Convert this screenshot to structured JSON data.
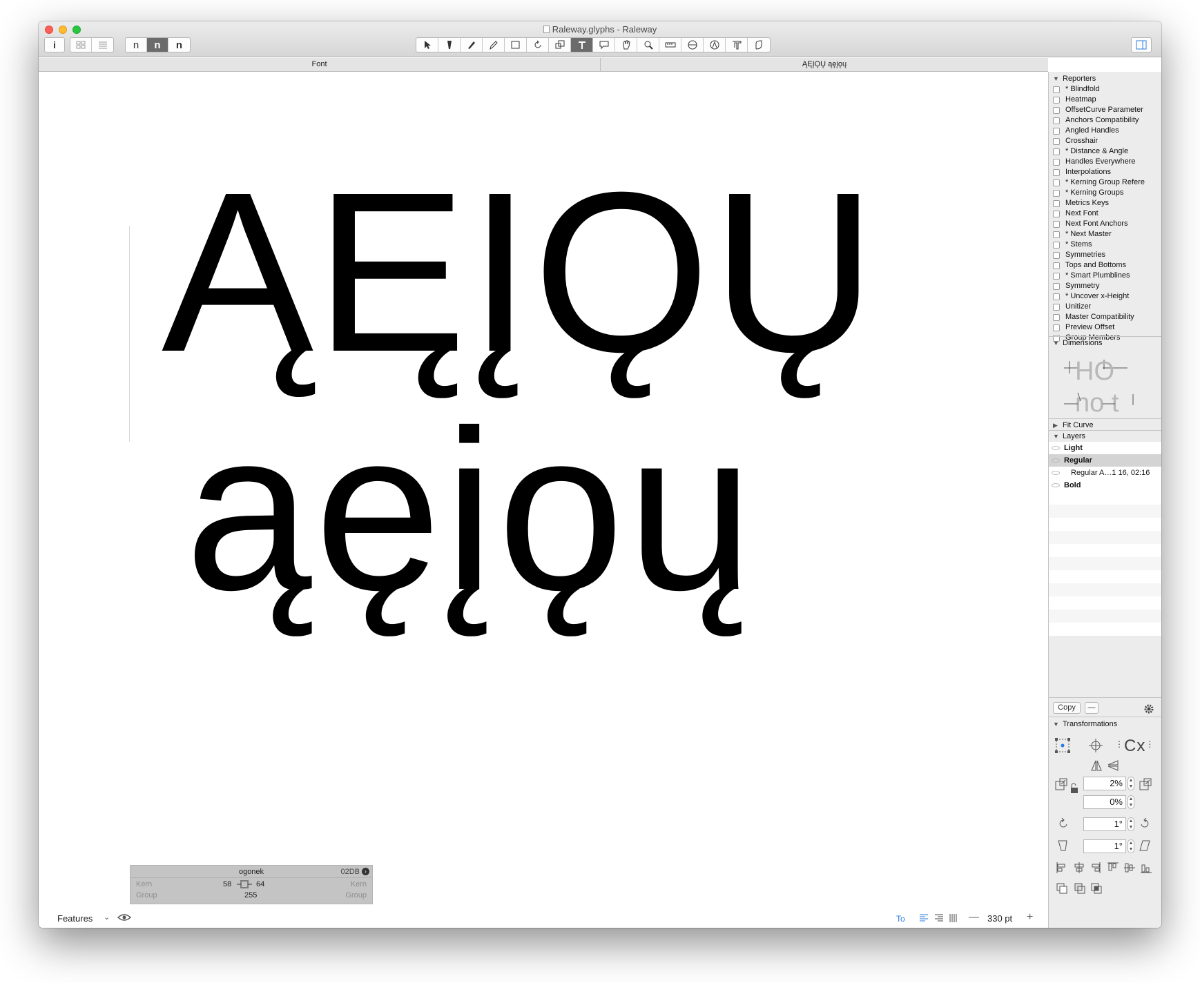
{
  "window": {
    "title": "Raleway.glyphs - Raleway"
  },
  "toolbar": {
    "info_label": "i",
    "preview_labels": [
      "n",
      "n",
      "n"
    ]
  },
  "tabs": [
    {
      "label": "Font"
    },
    {
      "label": "ĄĘĮǪŲ ąęįǫų"
    }
  ],
  "canvas": {
    "line1": "ĄĘĮǪŲ",
    "line2": "ąęįǫų"
  },
  "glyph_info": {
    "name": "ogonek",
    "unicode": "02DB",
    "kern_left_label": "Kern",
    "kern_right_label": "Kern",
    "group_left_label": "Group",
    "group_right_label": "Group",
    "lsb": "58",
    "rsb": "64",
    "width": "255"
  },
  "bottom_bar": {
    "features_label": "Features",
    "zoom": "330 pt",
    "zoom_minus": "—",
    "zoom_plus": "+"
  },
  "sidebar": {
    "reporters_title": "Reporters",
    "reporters": [
      "* Blindfold",
      "Heatmap",
      "OffsetCurve Parameter",
      "Anchors Compatibility",
      "Angled Handles",
      "Crosshair",
      "* Distance & Angle",
      "Handles Everywhere",
      "Interpolations",
      "* Kerning Group Refere",
      "* Kerning Groups",
      "Metrics Keys",
      "Next Font",
      "Next Font Anchors",
      "* Next Master",
      "* Stems",
      "Symmetries",
      "Tops and Bottoms",
      "* Smart Plumblines",
      "Symmetry",
      "* Uncover x-Height",
      "Unitizer",
      "Master Compatibility",
      "Preview Offset",
      "Group Members"
    ],
    "dimensions_title": "Dimensions",
    "dimensions_sample_top": "HO",
    "dimensions_sample_bottom": "no t",
    "fit_curve_title": "Fit Curve",
    "layers_title": "Layers",
    "layers": [
      {
        "name": "Light",
        "bold": true
      },
      {
        "name": "Regular",
        "bold": true,
        "selected": true
      },
      {
        "name": "Regular A…1 16, 02:16",
        "bold": false
      },
      {
        "name": "Bold",
        "bold": true
      }
    ],
    "copy_label": "Copy",
    "minus_label": "—",
    "transformations_title": "Transformations",
    "cx_label": "Cx",
    "scale_x": "2%",
    "scale_y": "0%",
    "rotate": "1°",
    "slant": "1°"
  },
  "colors": {
    "accent": "#2a7ae2",
    "selected_tool": "#6b6b6b"
  }
}
